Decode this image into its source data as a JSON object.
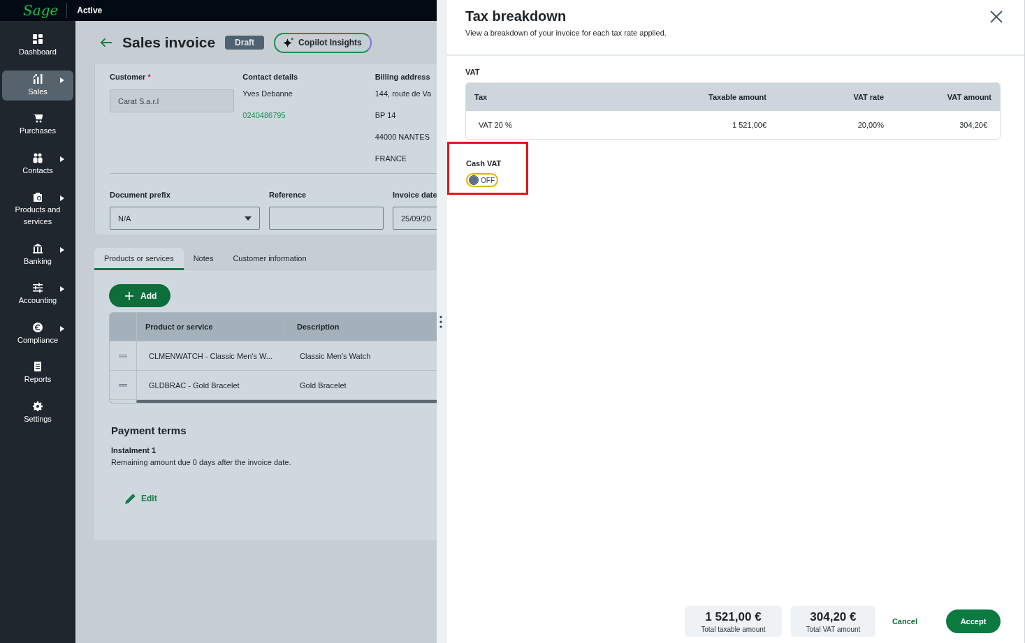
{
  "topbar": {
    "logo": "Sage",
    "status": "Active"
  },
  "sidebar": {
    "items": [
      {
        "label": "Dashboard",
        "selected": false,
        "submenu": false
      },
      {
        "label": "Sales",
        "selected": true,
        "submenu": true
      },
      {
        "label": "Purchases",
        "selected": false,
        "submenu": false
      },
      {
        "label": "Contacts",
        "selected": false,
        "submenu": true
      },
      {
        "label": "Products and services",
        "selected": false,
        "submenu": true
      },
      {
        "label": "Banking",
        "selected": false,
        "submenu": true
      },
      {
        "label": "Accounting",
        "selected": false,
        "submenu": true
      },
      {
        "label": "Compliance",
        "selected": false,
        "submenu": true
      },
      {
        "label": "Reports",
        "selected": false,
        "submenu": false
      },
      {
        "label": "Settings",
        "selected": false,
        "submenu": false
      }
    ]
  },
  "page": {
    "title": "Sales invoice",
    "status_badge": "Draft",
    "copilot_button": "Copilot Insights",
    "customer": {
      "label": "Customer",
      "required_mark": "*",
      "value": "Carat S.a.r.l"
    },
    "contact_details": {
      "label": "Contact details",
      "name": "Yves Debanne",
      "phone": "0240486795"
    },
    "billing_address": {
      "label": "Billing address",
      "lines": [
        "144, route de Va",
        "BP 14",
        "44000 NANTES",
        "FRANCE"
      ]
    },
    "document_prefix": {
      "label": "Document prefix",
      "value": "N/A"
    },
    "reference": {
      "label": "Reference"
    },
    "invoice_date": {
      "label": "Invoice date",
      "value": "25/09/20"
    },
    "tabs": [
      {
        "label": "Products or services",
        "selected": true
      },
      {
        "label": "Notes",
        "selected": false
      },
      {
        "label": "Customer information",
        "selected": false
      }
    ],
    "add_button": "Add",
    "table": {
      "columns": [
        "Product or service",
        "Description"
      ],
      "rows": [
        {
          "product": "CLMENWATCH - Classic Men's W...",
          "description": "Classic Men's Watch"
        },
        {
          "product": "GLDBRAC - Gold Bracelet",
          "description": "Gold Bracelet"
        }
      ]
    },
    "payment_terms": {
      "title": "Payment terms",
      "instalment": "Instalment 1",
      "text": "Remaining amount due 0 days after the invoice date.",
      "edit_link": "Edit"
    }
  },
  "drawer": {
    "title": "Tax breakdown",
    "subtitle": "View a breakdown of your invoice for each tax rate applied.",
    "section": "VAT",
    "table": {
      "columns": [
        "Tax",
        "Taxable amount",
        "VAT rate",
        "VAT amount"
      ],
      "rows": [
        {
          "tax": "VAT 20 %",
          "taxable_amount": "1 521,00€",
          "vat_rate": "20,00%",
          "vat_amount": "304,20€"
        }
      ]
    },
    "cash_vat": {
      "label": "Cash VAT",
      "on": false,
      "state_text": "OFF",
      "highlighted": true
    },
    "totals": [
      {
        "value": "1 521,00 €",
        "label": "Total taxable amount"
      },
      {
        "value": "304,20 €",
        "label": "Total VAT amount"
      }
    ],
    "cancel_button": "Cancel",
    "accept_button": "Accept"
  }
}
